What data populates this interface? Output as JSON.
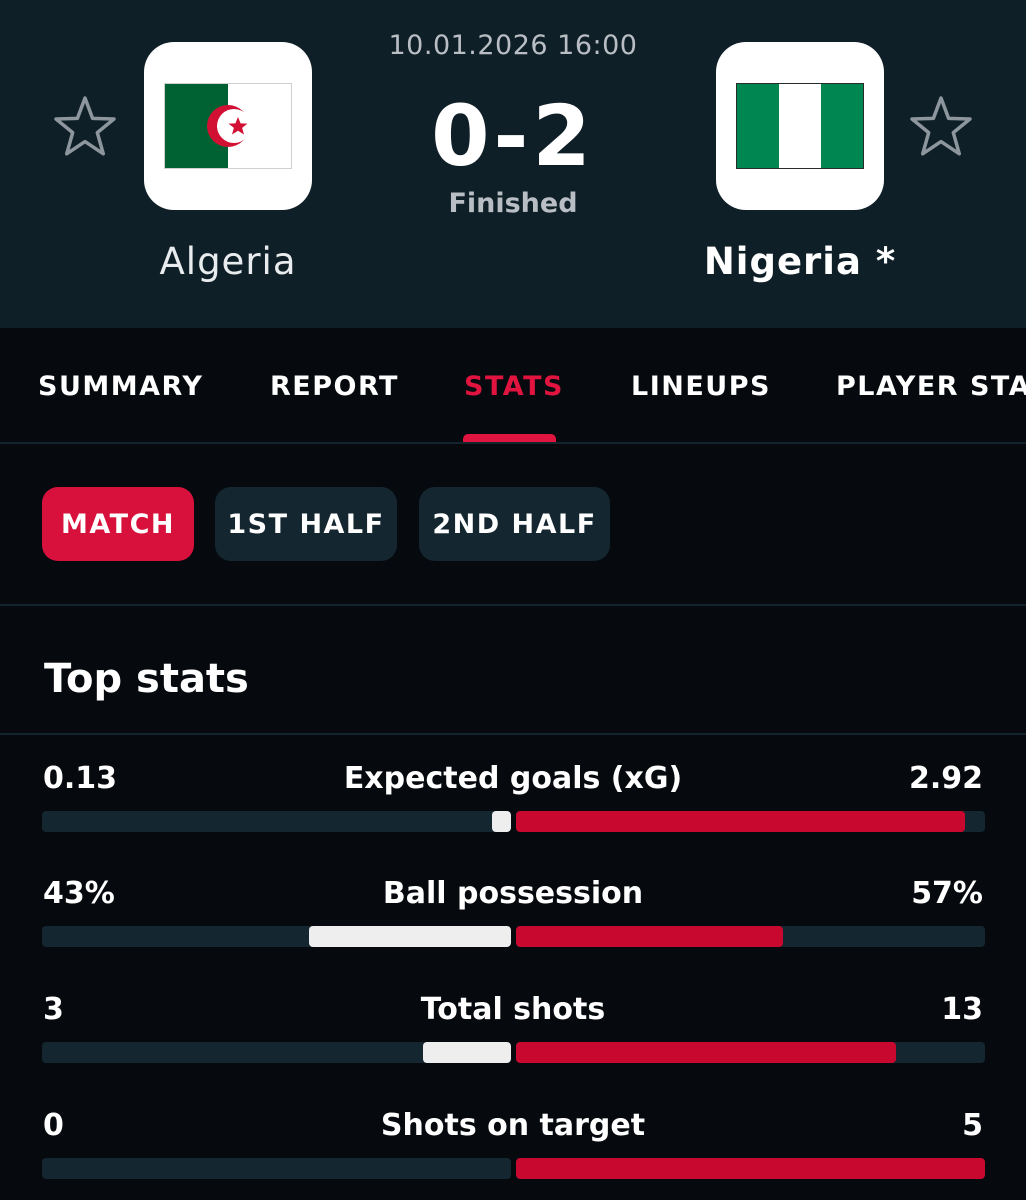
{
  "match": {
    "datetime": "10.01.2026 16:00",
    "score": "0-2",
    "status": "Finished",
    "home_team": "Algeria",
    "away_team": "Nigeria *",
    "home_crest": "algeria-flag-icon",
    "away_crest": "nigeria-flag-icon",
    "favorite_icon": "star-outline-icon"
  },
  "tabs": [
    {
      "label": "SUMMARY",
      "active": false
    },
    {
      "label": "REPORT",
      "active": false
    },
    {
      "label": "STATS",
      "active": true
    },
    {
      "label": "LINEUPS",
      "active": false
    },
    {
      "label": "PLAYER STATS",
      "active": false
    }
  ],
  "periods": [
    {
      "label": "MATCH",
      "active": true
    },
    {
      "label": "1ST HALF",
      "active": false
    },
    {
      "label": "2ND HALF",
      "active": false
    }
  ],
  "section_title": "Top stats",
  "stats": [
    {
      "label": "Expected goals (xG)",
      "home": "0.13",
      "away": "2.92",
      "home_fill": 0.04,
      "away_fill": 0.957
    },
    {
      "label": "Ball possession",
      "home": "43%",
      "away": "57%",
      "home_fill": 0.43,
      "away_fill": 0.57
    },
    {
      "label": "Total shots",
      "home": "3",
      "away": "13",
      "home_fill": 0.188,
      "away_fill": 0.81
    },
    {
      "label": "Shots on target",
      "home": "0",
      "away": "5",
      "home_fill": 0.0,
      "away_fill": 1.0
    }
  ],
  "colors": {
    "accent": "#e0143f",
    "header_bg": "#0f1f27",
    "page_bg": "#060a0f",
    "track": "#14262f",
    "home_bar": "#eeeeee",
    "away_bar": "#c9082f",
    "algeria_green": "#006233",
    "algeria_red": "#d21034",
    "nigeria_green": "#008751"
  }
}
